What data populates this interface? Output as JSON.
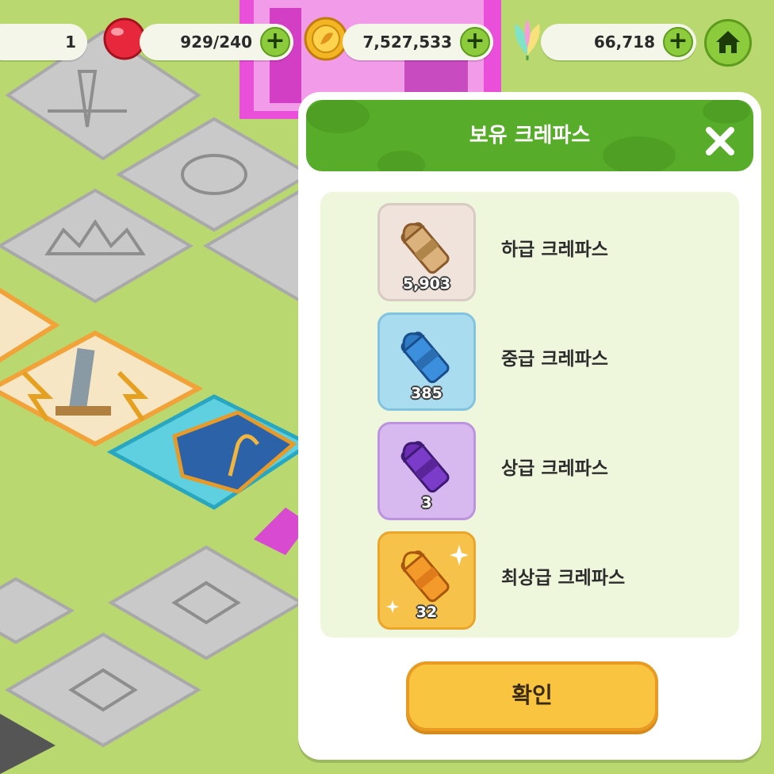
{
  "topbar": {
    "level_value": "1",
    "jelly_value": "929/240",
    "coin_value": "7,527,533",
    "crystal_value": "66,718",
    "plus_symbol": "+"
  },
  "panel": {
    "title": "보유 크레파스",
    "items": [
      {
        "name": "하급 크레파스",
        "count": "5,903",
        "color": "#d9b48a"
      },
      {
        "name": "중급 크레파스",
        "count": "385",
        "color": "#3a8fd6"
      },
      {
        "name": "상급 크레파스",
        "count": "3",
        "color": "#7b3cc9"
      },
      {
        "name": "최상급 크레파스",
        "count": "32",
        "color": "#f0a020"
      }
    ],
    "confirm_label": "확인"
  },
  "colors": {
    "accent_green": "#57ad2a",
    "button_yellow": "#f9c540"
  }
}
